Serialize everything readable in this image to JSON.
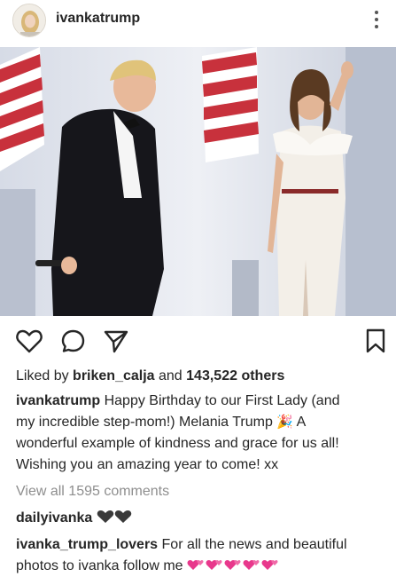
{
  "post": {
    "username": "ivankatrump",
    "liked_by_prefix": "Liked by",
    "liked_by_user": "briken_calja",
    "liked_by_and": "and",
    "liked_by_count": "143,522 others",
    "caption_user": "ivankatrump",
    "caption_line1": "Happy Birthday to our First Lady (and",
    "caption_line2_a": "my incredible step-mom!) Melania Trump",
    "caption_line2_emoji": "🎉",
    "caption_line2_b": "A",
    "caption_line3": "wonderful example of kindness and grace for us all!",
    "caption_line4": "Wishing you an amazing year to come! xx",
    "view_comments": "View all 1595 comments"
  },
  "comments": [
    {
      "user": "dailyivanka",
      "text": "",
      "emoji": "black-hearts"
    },
    {
      "user": "ivanka_trump_lovers",
      "text_line1": "For all the news and beautiful",
      "text_line2": "photos to ivanka follow me",
      "emoji": "pink-two-hearts"
    }
  ],
  "icons": [
    "avatar",
    "more-vertical-icon",
    "heart-icon",
    "comment-icon",
    "share-icon",
    "bookmark-icon"
  ],
  "colors": {
    "text": "#262626",
    "muted": "#8e8e8e",
    "pink_heart": "#e8388c"
  }
}
